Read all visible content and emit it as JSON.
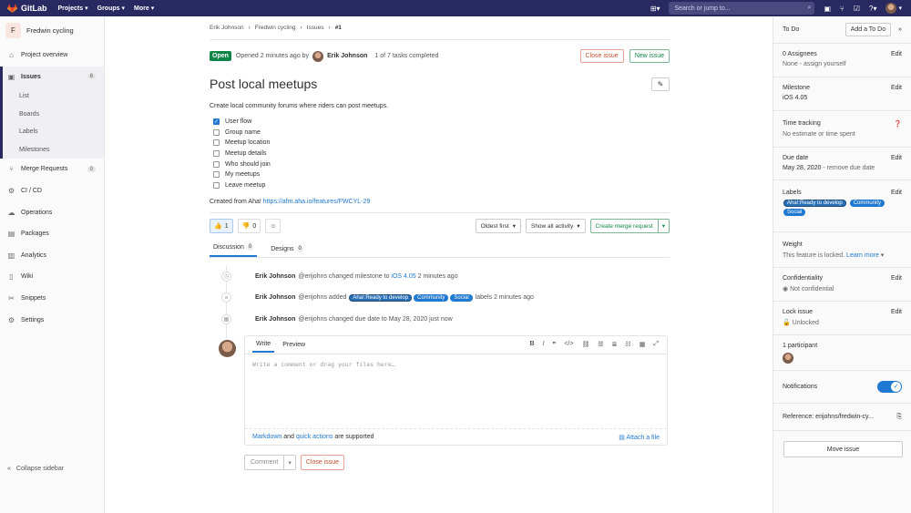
{
  "topbar": {
    "brand": "GitLab",
    "nav": [
      "Projects",
      "Groups",
      "More"
    ],
    "search_placeholder": "Search or jump to..."
  },
  "sidebar": {
    "project_initial": "F",
    "project_name": "Fredwin cycling",
    "items": [
      {
        "label": "Project overview",
        "icon": "home-icon"
      },
      {
        "label": "Issues",
        "icon": "issues-icon",
        "count": "8"
      },
      {
        "label": "Merge Requests",
        "icon": "merge-request-icon",
        "count": "0"
      },
      {
        "label": "CI / CD",
        "icon": "rocket-icon"
      },
      {
        "label": "Operations",
        "icon": "cloud-icon"
      },
      {
        "label": "Packages",
        "icon": "package-icon"
      },
      {
        "label": "Analytics",
        "icon": "chart-icon"
      },
      {
        "label": "Wiki",
        "icon": "book-icon"
      },
      {
        "label": "Snippets",
        "icon": "scissors-icon"
      },
      {
        "label": "Settings",
        "icon": "gear-icon"
      }
    ],
    "sub": [
      "List",
      "Boards",
      "Labels",
      "Milestones"
    ],
    "collapse": "Collapse sidebar"
  },
  "breadcrumb": [
    "Erik Johnson",
    "Fredwin cycling",
    "Issues",
    "#1"
  ],
  "issue": {
    "status": "Open",
    "opened": "Opened 2 minutes ago by",
    "author": "Erik Johnson",
    "tasks_done": "1 of 7 tasks completed",
    "close_btn": "Close issue",
    "new_btn": "New issue",
    "title": "Post local meetups",
    "description": "Create local community forums where riders can post meetups.",
    "tasks": [
      {
        "label": "User flow",
        "checked": true
      },
      {
        "label": "Group name",
        "checked": false
      },
      {
        "label": "Meetup location",
        "checked": false
      },
      {
        "label": "Meetup details",
        "checked": false
      },
      {
        "label": "Who should join",
        "checked": false
      },
      {
        "label": "My meetups",
        "checked": false
      },
      {
        "label": "Leave meetup",
        "checked": false
      }
    ],
    "created_from": "Created from Aha!",
    "link": "https://afm.aha.io/features/FWCYL-29"
  },
  "actions": {
    "thumbs_up": "1",
    "thumbs_down": "0",
    "sort": "Oldest first",
    "filter": "Show all activity",
    "merge_request": "Create merge request"
  },
  "tabs": [
    {
      "label": "Discussion",
      "count": "0"
    },
    {
      "label": "Designs",
      "count": "0"
    }
  ],
  "notes": [
    {
      "author": "Erik Johnson",
      "handle": "@erijohns",
      "text": "changed milestone to",
      "link": "iOS 4.05",
      "time": "2 minutes ago"
    },
    {
      "author": "Erik Johnson",
      "handle": "@erijohns",
      "text": "added",
      "labels": [
        "Aha!:Ready to develop",
        "Community",
        "Social"
      ],
      "tail": "labels 2 minutes ago"
    },
    {
      "author": "Erik Johnson",
      "handle": "@erijohns",
      "text": "changed due date to May 28, 2020 just now"
    }
  ],
  "editor": {
    "write": "Write",
    "preview": "Preview",
    "placeholder": "Write a comment or drag your files here…",
    "markdown": "Markdown",
    "and": "and",
    "quick_actions": "quick actions",
    "supported": "are supported",
    "attach": "Attach a file",
    "comment": "Comment",
    "close": "Close issue"
  },
  "right": {
    "todo": "To Do",
    "add_todo": "Add a To Do",
    "assignees": "0 Assignees",
    "assignees_none": "None - assign yourself",
    "milestone": "Milestone",
    "milestone_val": "iOS 4.05",
    "time": "Time tracking",
    "time_val": "No estimate or time spent",
    "due": "Due date",
    "due_val": "May 28, 2020",
    "due_remove": "- remove due date",
    "labels": "Labels",
    "label_list": [
      "Aha!:Ready to develop",
      "Community",
      "Social"
    ],
    "weight": "Weight",
    "weight_val": "This feature is locked.",
    "learn": "Learn more",
    "conf": "Confidentiality",
    "conf_val": "Not confidential",
    "lock": "Lock issue",
    "lock_val": "Unlocked",
    "participants": "1 participant",
    "notifications": "Notifications",
    "reference": "Reference: erijohns/fredwin-cy...",
    "move": "Move issue",
    "edit": "Edit"
  },
  "colors": {
    "topbar": "#292961",
    "accent": "#1f78d1",
    "open": "#108548",
    "danger": "#c64f2d"
  }
}
